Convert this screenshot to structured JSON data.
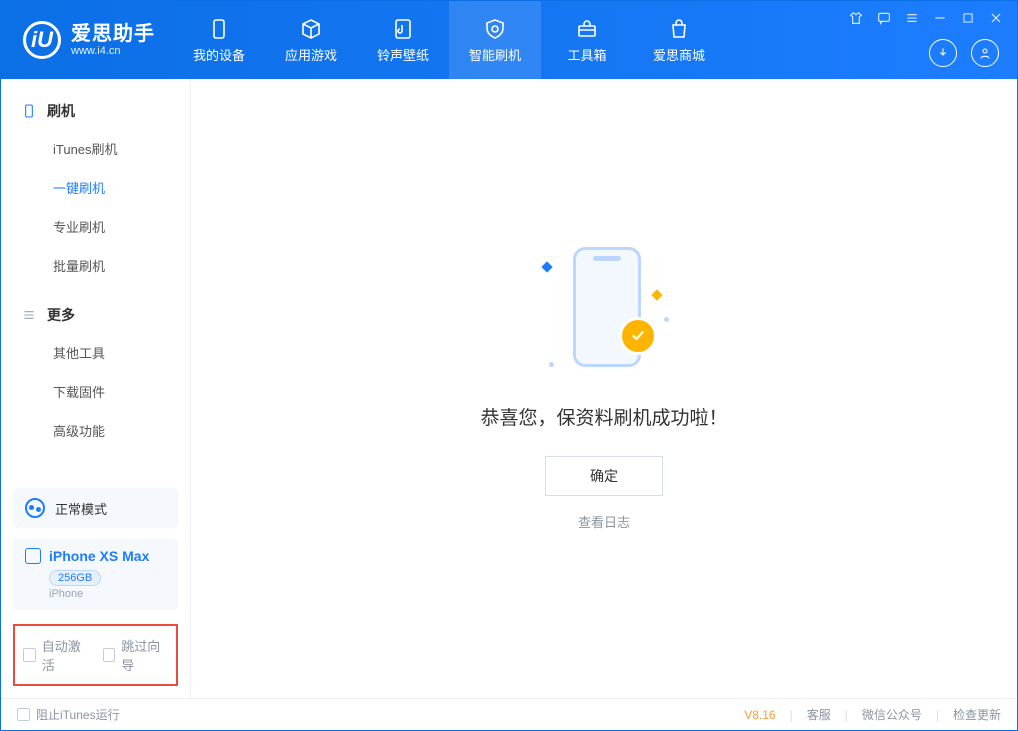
{
  "logo": {
    "glyph": "iU",
    "cn": "爱思助手",
    "url": "www.i4.cn"
  },
  "nav": {
    "items": [
      {
        "label": "我的设备"
      },
      {
        "label": "应用游戏"
      },
      {
        "label": "铃声壁纸"
      },
      {
        "label": "智能刷机"
      },
      {
        "label": "工具箱"
      },
      {
        "label": "爱思商城"
      }
    ]
  },
  "sidebar": {
    "group1": {
      "title": "刷机",
      "items": [
        "iTunes刷机",
        "一键刷机",
        "专业刷机",
        "批量刷机"
      ]
    },
    "group2": {
      "title": "更多",
      "items": [
        "其他工具",
        "下载固件",
        "高级功能"
      ]
    }
  },
  "mode": {
    "label": "正常模式"
  },
  "device": {
    "name": "iPhone XS Max",
    "capacity": "256GB",
    "sub": "iPhone"
  },
  "opts": {
    "auto_activate": "自动激活",
    "skip_guide": "跳过向导"
  },
  "main": {
    "success_msg": "恭喜您，保资料刷机成功啦！",
    "ok": "确定",
    "view_log": "查看日志"
  },
  "footer": {
    "block_itunes": "阻止iTunes运行",
    "version": "V8.16",
    "support": "客服",
    "wechat": "微信公众号",
    "update": "检查更新"
  }
}
